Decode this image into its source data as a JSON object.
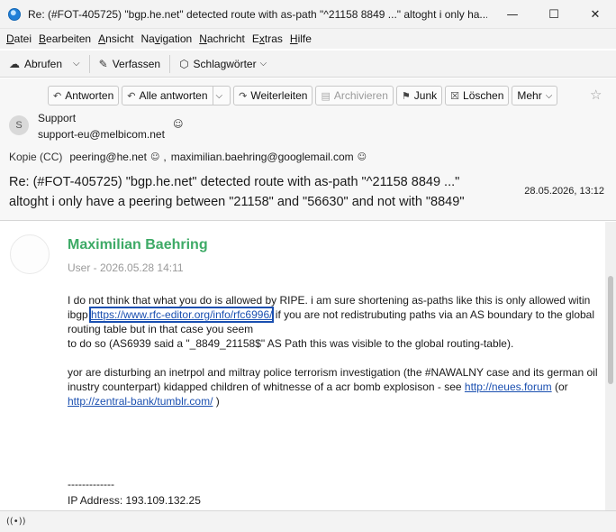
{
  "window": {
    "title": "Re: (#FOT-405725) \"bgp.he.net\" detected route with as-path \"^21158 8849 ...\" altoght i only ha...",
    "controls": [
      "—",
      "☐",
      "✕"
    ]
  },
  "menubar": {
    "items": [
      {
        "pre": "",
        "key": "D",
        "post": "atei"
      },
      {
        "pre": "",
        "key": "B",
        "post": "earbeiten"
      },
      {
        "pre": "",
        "key": "A",
        "post": "nsicht"
      },
      {
        "pre": "Na",
        "key": "v",
        "post": "igation"
      },
      {
        "pre": "",
        "key": "N",
        "post": "achricht"
      },
      {
        "pre": "E",
        "key": "x",
        "post": "tras"
      },
      {
        "pre": "",
        "key": "H",
        "post": "ilfe"
      }
    ]
  },
  "toolbar": {
    "fetch_label": "Abrufen",
    "compose_label": "Verfassen",
    "tags_label": "Schlagwörter"
  },
  "actions": {
    "reply": "Antworten",
    "reply_all": "Alle antworten",
    "forward": "Weiterleiten",
    "archive": "Archivieren",
    "junk": "Junk",
    "delete": "Löschen",
    "more": "Mehr"
  },
  "message_header": {
    "sender_initial": "S",
    "sender_name": "Support",
    "sender_email": "support-eu@melbicom.net",
    "cc_label": "Kopie (CC)",
    "cc_1": "peering@he.net",
    "cc_sep": ",",
    "cc_2": "maximilian.baehring@googlemail.com",
    "subject_line1": "Re: (#FOT-405725) \"bgp.he.net\" detected route with as-path \"^21158 8849 ...\"",
    "subject_line2": "altoght i only have a peering between \"21158\" and \"56630\" and not with \"8849\"",
    "date": "28.05.2026, 13:12"
  },
  "message_body": {
    "author": "Maximilian Baehring",
    "meta": "User - 2026.05.28 14:11",
    "p1_a": "I do not think that what you do is allowed by RIPE. i am sure shortening as-paths like this is only allowed witin ibgp ",
    "p1_link": "https://www.rfc-editor.org/info/rfc6996/",
    "p1_b": " if you are not redistrubuting paths via an AS boundary to the global routing table but in that case you seem",
    "p1_c": "to do so (AS6939 said a \"_8849_21158$\" AS Path this was visible to the global routing-table).",
    "p2_a": "yor are disturbing an inetrpol and miltray police terrorism investigation (the #NAWALNY case and its german oil inustry counterpart) kidapped children of whitnesse of a acr bomb explosison - see ",
    "p2_link1": "http://neues.forum",
    "p2_b": " (or ",
    "p2_link2": "http://zentral-bank/tumblr.com/",
    "p2_c": " )",
    "signature_sep": "-------------",
    "ip": "IP Address: 193.109.132.25"
  }
}
